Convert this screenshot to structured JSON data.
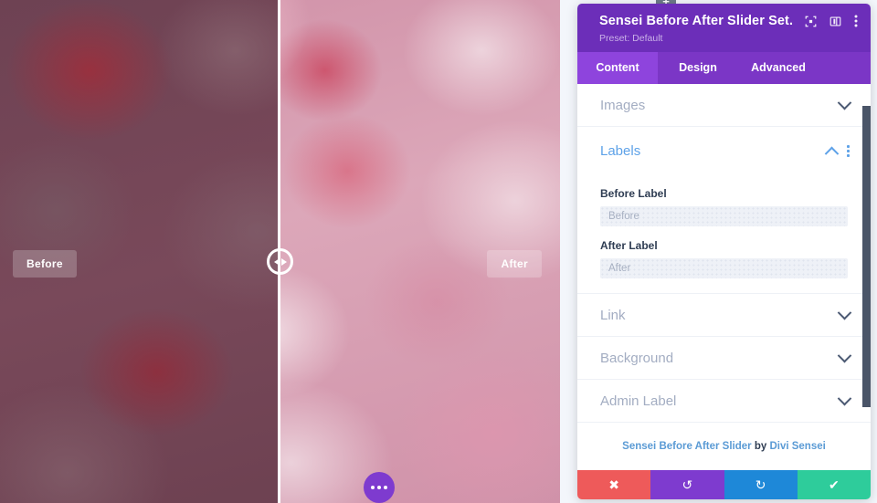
{
  "preview": {
    "before_label": "Before",
    "after_label": "After",
    "handle_icon": "drag-handle-arrows-icon",
    "module_actions_icon": "ellipsis-icon",
    "add_module_label": "+"
  },
  "modal": {
    "title": "Sensei Before After Slider Set...",
    "preset": "Preset: Default",
    "header_icons": [
      {
        "name": "focus-icon",
        "glyph": "⬚"
      },
      {
        "name": "layout-columns-icon",
        "glyph": "▤"
      },
      {
        "name": "more-options-icon",
        "glyph": "⋮"
      }
    ],
    "tabs": [
      {
        "label": "Content",
        "active": true
      },
      {
        "label": "Design",
        "active": false
      },
      {
        "label": "Advanced",
        "active": false
      }
    ],
    "sections": [
      {
        "title": "Images",
        "open": false
      },
      {
        "title": "Labels",
        "open": true
      },
      {
        "title": "Link",
        "open": false
      },
      {
        "title": "Background",
        "open": false
      },
      {
        "title": "Admin Label",
        "open": false
      }
    ],
    "labels_fields": {
      "before": {
        "label": "Before Label",
        "value": "",
        "placeholder": "Before"
      },
      "after": {
        "label": "After Label",
        "value": "",
        "placeholder": "After"
      }
    },
    "credit": {
      "product": "Sensei Before After Slider",
      "by": " by ",
      "author": "Divi Sensei"
    },
    "footer_buttons": [
      {
        "name": "cancel-button",
        "glyph": "✖",
        "color": "#ee5a5a"
      },
      {
        "name": "undo-button",
        "glyph": "↺",
        "color": "#7e3bcf"
      },
      {
        "name": "redo-button",
        "glyph": "↻",
        "color": "#1e88d8"
      },
      {
        "name": "save-button",
        "glyph": "✔",
        "color": "#2ecc9b"
      }
    ]
  },
  "colors": {
    "header_purple": "#6c2eb9",
    "tab_purple": "#7b36c6",
    "tab_active_purple": "#8e44dd",
    "accent_blue": "#5ea2e8"
  }
}
